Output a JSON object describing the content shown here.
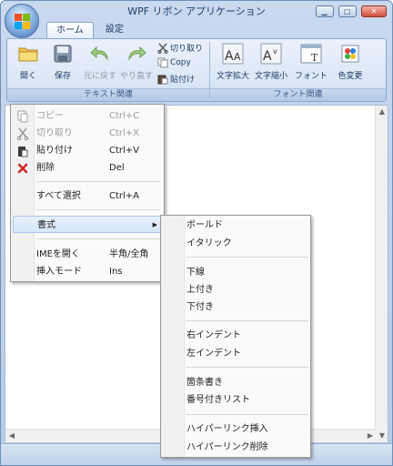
{
  "window": {
    "title": "WPF リボン アプリケーション"
  },
  "tabs": [
    {
      "label": "ホーム"
    },
    {
      "label": "設定"
    }
  ],
  "ribbon": {
    "text_group": {
      "label": "テキスト関連",
      "buttons": {
        "open": "開く",
        "save": "保存",
        "undo": "元に戻す",
        "redo": "やり直す",
        "cut": "切り取り",
        "copy": "Copy",
        "paste": "貼付け"
      }
    },
    "font_group": {
      "label": "フォント関連",
      "buttons": {
        "enlarge": "文字拡大",
        "shrink": "文字縮小",
        "font": "フォント",
        "color": "色変更"
      }
    }
  },
  "context_menu": {
    "items": [
      {
        "label": "コピー",
        "shortcut": "Ctrl+C",
        "icon": "copy-icon",
        "disabled": true
      },
      {
        "label": "切り取り",
        "shortcut": "Ctrl+X",
        "icon": "scissors-icon",
        "disabled": true
      },
      {
        "label": "貼り付け",
        "shortcut": "Ctrl+V",
        "icon": "paste-icon",
        "disabled": false
      },
      {
        "label": "削除",
        "shortcut": "Del",
        "icon": "delete-icon",
        "disabled": false
      },
      {
        "label": "すべて選択",
        "shortcut": "Ctrl+A"
      },
      {
        "label": "書式",
        "shortcut": "",
        "has_submenu": true
      },
      {
        "label": "IMEを開く",
        "shortcut": "半角/全角"
      },
      {
        "label": "挿入モード",
        "shortcut": "Ins"
      }
    ]
  },
  "submenu": {
    "items": [
      {
        "label": "ボールド"
      },
      {
        "label": "イタリック"
      },
      {
        "label": "下線"
      },
      {
        "label": "上付き"
      },
      {
        "label": "下付き"
      },
      {
        "label": "右インデント"
      },
      {
        "label": "左インデント"
      },
      {
        "label": "箇条書き"
      },
      {
        "label": "番号付きリスト"
      },
      {
        "label": "ハイパーリンク挿入"
      },
      {
        "label": "ハイパーリンク削除"
      }
    ]
  },
  "colors": {
    "accent": "#3d6fb3",
    "menu_highlight": "#d5e6fa",
    "delete_red": "#d12a1e"
  }
}
